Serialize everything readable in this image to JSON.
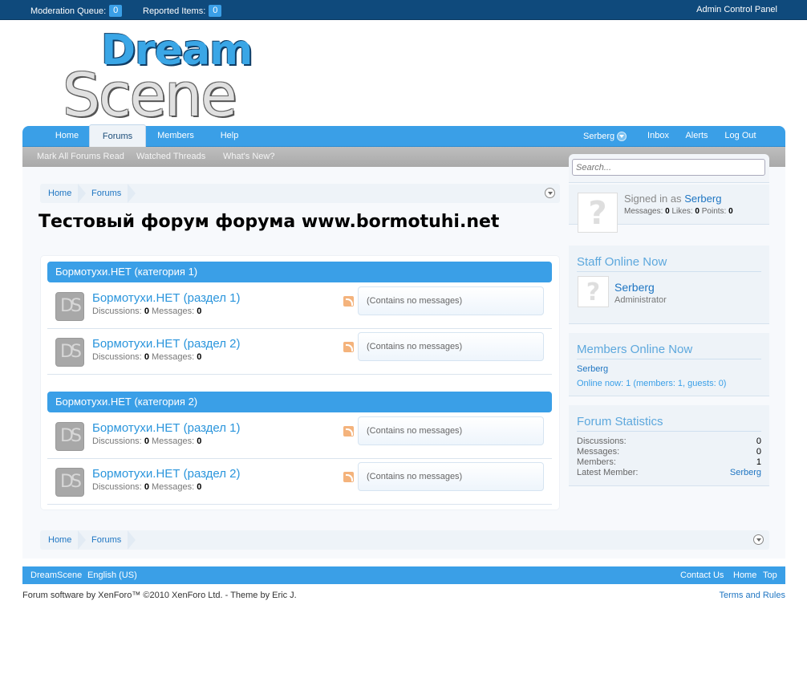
{
  "adminbar": {
    "moderation_label": "Moderation Queue:",
    "moderation_count": "0",
    "reported_label": "Reported Items:",
    "reported_count": "0",
    "acp_label": "Admin Control Panel"
  },
  "logo": {
    "line1": "Dream",
    "line2": "Scene"
  },
  "nav": {
    "tabs": [
      {
        "label": "Home"
      },
      {
        "label": "Forums"
      },
      {
        "label": "Members"
      },
      {
        "label": "Help"
      }
    ],
    "username": "Serberg",
    "right": [
      {
        "label": "Inbox"
      },
      {
        "label": "Alerts"
      },
      {
        "label": "Log Out"
      }
    ]
  },
  "subnav": {
    "links": [
      {
        "label": "Mark All Forums Read"
      },
      {
        "label": "Watched Threads"
      },
      {
        "label": "What's New?"
      }
    ]
  },
  "breadcrumb": {
    "items": [
      "Home",
      "Forums"
    ]
  },
  "page_title": "Тестовый форум форума www.bormotuhi.net",
  "categories": [
    {
      "title": "Бормотухи.НЕТ (категория 1)",
      "forums": [
        {
          "title": "Бормотухи.НЕТ (раздел 1)",
          "discussions_label": "Discussions:",
          "discussions": "0",
          "messages_label": "Messages:",
          "messages": "0",
          "last_post": "(Contains no messages)"
        },
        {
          "title": "Бормотухи.НЕТ (раздел 2)",
          "discussions_label": "Discussions:",
          "discussions": "0",
          "messages_label": "Messages:",
          "messages": "0",
          "last_post": "(Contains no messages)"
        }
      ]
    },
    {
      "title": "Бормотухи.НЕТ (категория 2)",
      "forums": [
        {
          "title": "Бормотухи.НЕТ (раздел 1)",
          "discussions_label": "Discussions:",
          "discussions": "0",
          "messages_label": "Messages:",
          "messages": "0",
          "last_post": "(Contains no messages)"
        },
        {
          "title": "Бормотухи.НЕТ (раздел 2)",
          "discussions_label": "Discussions:",
          "discussions": "0",
          "messages_label": "Messages:",
          "messages": "0",
          "last_post": "(Contains no messages)"
        }
      ]
    }
  ],
  "forum_icon_text": "DS",
  "sidebar": {
    "search_placeholder": "Search...",
    "visitor": {
      "signed_in_label": "Signed in as",
      "username": "Serberg",
      "messages_label": "Messages:",
      "messages": "0",
      "likes_label": "Likes:",
      "likes": "0",
      "points_label": "Points:",
      "points": "0"
    },
    "staff": {
      "title": "Staff Online Now",
      "name": "Serberg",
      "role": "Administrator"
    },
    "members_online": {
      "title": "Members Online Now",
      "name": "Serberg",
      "summary": "Online now: 1 (members: 1, guests: 0)"
    },
    "stats": {
      "title": "Forum Statistics",
      "rows": [
        {
          "label": "Discussions:",
          "value": "0"
        },
        {
          "label": "Messages:",
          "value": "0"
        },
        {
          "label": "Members:",
          "value": "1"
        },
        {
          "label": "Latest Member:",
          "value": "Serberg"
        }
      ]
    }
  },
  "footer": {
    "site": "DreamScene",
    "language": "English (US)",
    "contact": "Contact Us",
    "home": "Home",
    "top": "Top",
    "copyright": "Forum software by XenForo™ ©2010 XenForo Ltd. - Theme by Eric J.",
    "terms": "Terms and Rules"
  },
  "colors": {
    "accent": "#3a9fe7",
    "adminbar": "#0f4a7c",
    "link": "#1e75c2",
    "subnav": "#b4b4b4"
  },
  "icons": [
    "dropdown-chevron-icon",
    "rss-icon",
    "jump-menu-icon",
    "forum-node-icon",
    "default-avatar-icon"
  ]
}
